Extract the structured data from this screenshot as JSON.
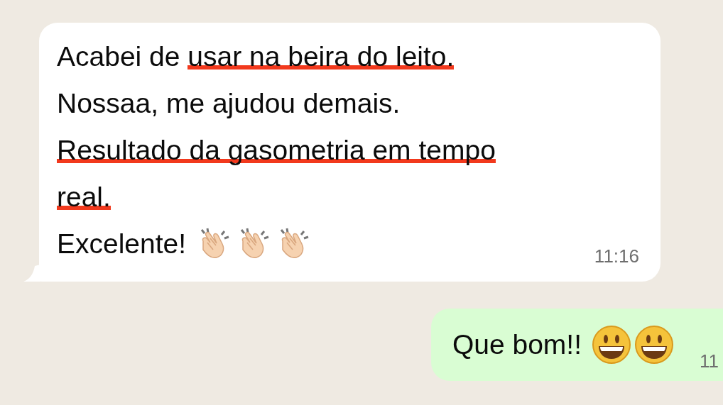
{
  "messages": [
    {
      "kind": "incoming",
      "lines": [
        [
          {
            "text": "Acabei de ",
            "marked": false
          },
          {
            "text": "usar na beira do leito.",
            "marked": true
          }
        ],
        [
          {
            "text": "Nossaa, me ajudou demais.",
            "marked": false
          }
        ],
        [
          {
            "text": "Resultado da gasometria em tempo",
            "marked": true
          }
        ],
        [
          {
            "text": "real.",
            "marked": true
          }
        ],
        [
          {
            "text": "Excelente!",
            "marked": false
          }
        ]
      ],
      "emoji": [
        {
          "kind": "clap"
        },
        {
          "kind": "clap"
        },
        {
          "kind": "clap"
        }
      ],
      "time": "11:16"
    },
    {
      "kind": "outgoing",
      "lines": [
        [
          {
            "text": "Que bom!!",
            "marked": false
          }
        ]
      ],
      "emoji": [
        {
          "kind": "smile"
        },
        {
          "kind": "smile"
        }
      ],
      "time": "11"
    }
  ]
}
